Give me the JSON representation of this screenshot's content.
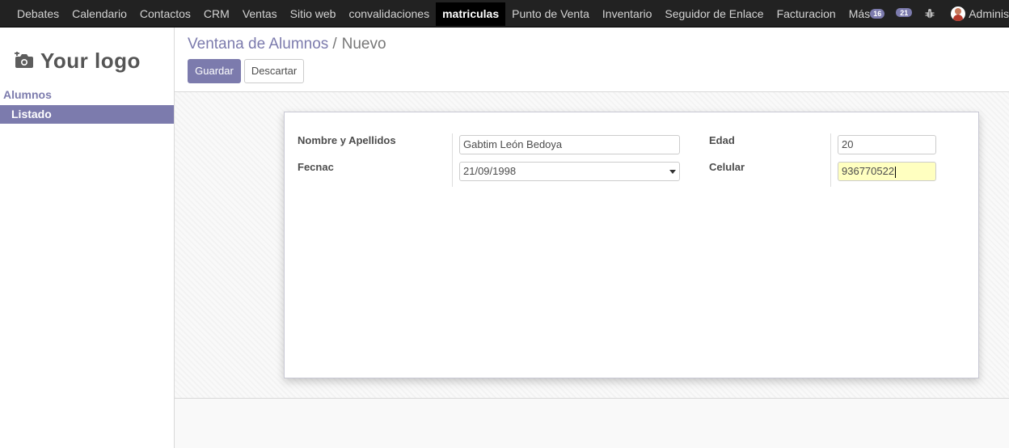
{
  "topbar": {
    "menu": [
      {
        "label": "Debates"
      },
      {
        "label": "Calendario"
      },
      {
        "label": "Contactos"
      },
      {
        "label": "CRM"
      },
      {
        "label": "Ventas"
      },
      {
        "label": "Sitio web"
      },
      {
        "label": "convalidaciones"
      },
      {
        "label": "matriculas",
        "active": true
      },
      {
        "label": "Punto de Venta"
      },
      {
        "label": "Inventario"
      },
      {
        "label": "Seguidor de Enlace"
      },
      {
        "label": "Facturacion"
      }
    ],
    "more_label": "Más",
    "activity_count": "16",
    "messages_count": "21",
    "user_name": "Adminis"
  },
  "sidebar": {
    "logo_text": "Your logo",
    "section": "Alumnos",
    "items": [
      {
        "label": "Listado",
        "active": true
      }
    ]
  },
  "control": {
    "breadcrumb": {
      "parent": "Ventana de Alumnos",
      "separator": "/",
      "current": "Nuevo"
    },
    "save_label": "Guardar",
    "discard_label": "Descartar"
  },
  "form": {
    "name": {
      "label": "Nombre y Apellidos",
      "value": "Gabtim León Bedoya"
    },
    "birthdate": {
      "label": "Fecnac",
      "value": "21/09/1998"
    },
    "age": {
      "label": "Edad",
      "value": "20"
    },
    "phone": {
      "label": "Celular",
      "value": "936770522"
    }
  },
  "colors": {
    "primary": "#7c7bad",
    "navbar": "#222222",
    "highlight_field": "#ffffc0"
  }
}
